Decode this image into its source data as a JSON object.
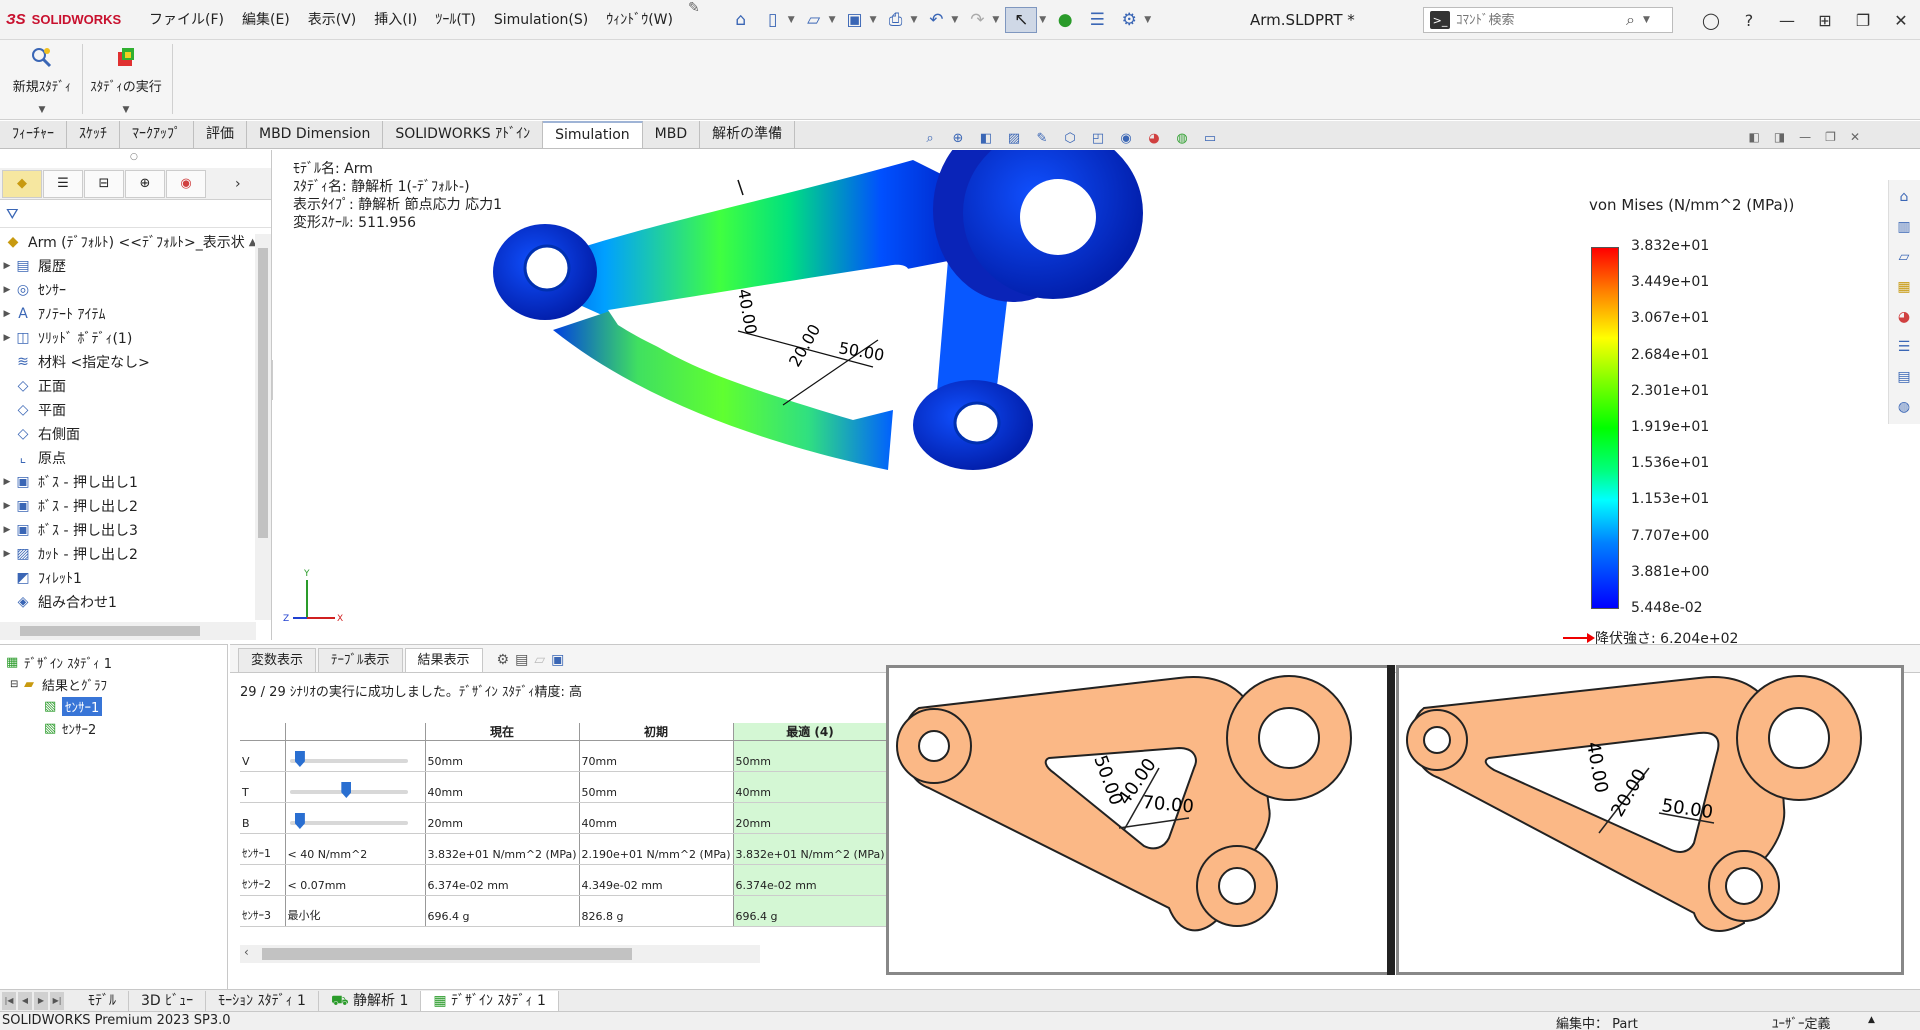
{
  "app": {
    "brand": "SOLIDWORKS",
    "doc_title": "Arm.SLDPRT *",
    "menus": [
      "ファイル(F)",
      "編集(E)",
      "表示(V)",
      "挿入(I)",
      "ﾂｰﾙ(T)",
      "Simulation(S)",
      "ｳｨﾝﾄﾞｳ(W)"
    ],
    "search_placeholder": "ｺﾏﾝﾄﾞ検索"
  },
  "command_manager": {
    "new_study": "新規ｽﾀﾃﾞｨ",
    "run_study": "ｽﾀﾃﾞｨの実行",
    "tabs": [
      "ﾌｨｰﾁｬｰ",
      "ｽｹｯﾁ",
      "ﾏｰｸｱｯﾌﾟ",
      "評価",
      "MBD Dimension",
      "SOLIDWORKS ｱﾄﾞｲﾝ",
      "Simulation",
      "MBD",
      "解析の準備"
    ],
    "active_tab": "Simulation"
  },
  "feature_tree": {
    "root": "Arm (ﾃﾞﾌｫﾙﾄ) <<ﾃﾞﾌｫﾙﾄ>_表示状",
    "items": [
      {
        "label": "履歴",
        "icon": "history-icon",
        "expandable": true
      },
      {
        "label": "ｾﾝｻｰ",
        "icon": "sensor-icon",
        "expandable": true
      },
      {
        "label": "ｱﾉﾃｰﾄ ｱｲﾃﾑ",
        "icon": "annotation-icon",
        "expandable": true
      },
      {
        "label": "ｿﾘｯﾄﾞ ﾎﾞﾃﾞｨ(1)",
        "icon": "solid-body-icon",
        "expandable": true
      },
      {
        "label": "材料 <指定なし>",
        "icon": "material-icon",
        "expandable": false
      },
      {
        "label": "正面",
        "icon": "plane-icon",
        "expandable": false
      },
      {
        "label": "平面",
        "icon": "plane-icon",
        "expandable": false
      },
      {
        "label": "右側面",
        "icon": "plane-icon",
        "expandable": false
      },
      {
        "label": "原点",
        "icon": "origin-icon",
        "expandable": false
      },
      {
        "label": "ﾎﾞｽ - 押し出し1",
        "icon": "boss-extrude-icon",
        "expandable": true
      },
      {
        "label": "ﾎﾞｽ - 押し出し2",
        "icon": "boss-extrude-icon",
        "expandable": true
      },
      {
        "label": "ﾎﾞｽ - 押し出し3",
        "icon": "boss-extrude-icon",
        "expandable": true
      },
      {
        "label": "ｶｯﾄ - 押し出し2",
        "icon": "cut-extrude-icon",
        "expandable": true
      },
      {
        "label": "ﾌｨﾚｯﾄ1",
        "icon": "fillet-icon",
        "expandable": false
      },
      {
        "label": "組み合わせ1",
        "icon": "combine-icon",
        "expandable": false
      }
    ]
  },
  "graphics": {
    "info_lines": [
      "ﾓﾃﾞﾙ名: Arm",
      "ｽﾀﾃﾞｨ名: 静解析 1(-ﾃﾞﾌｫﾙﾄ-)",
      "表示ﾀｲﾌﾟ: 静解析 節点応力 応力1",
      "変形ｽｹｰﾙ: 511.956"
    ],
    "dims": [
      "40.00",
      "20.00",
      "50.00"
    ],
    "legend_title": "von Mises (N/mm^2 (MPa))",
    "legend_values": [
      "3.832e+01",
      "3.449e+01",
      "3.067e+01",
      "2.684e+01",
      "2.301e+01",
      "1.919e+01",
      "1.536e+01",
      "1.153e+01",
      "7.707e+00",
      "3.881e+00",
      "5.448e-02"
    ],
    "yield": "降伏強さ: 6.204e+02",
    "triad": {
      "x": "X",
      "y": "Y",
      "z": "Z"
    }
  },
  "design_study_tree": {
    "root": "ﾃﾞｻﾞｲﾝ ｽﾀﾃﾞｨ 1",
    "results": "結果とｸﾞﾗﾌ",
    "sensors": [
      "ｾﾝｻｰ1",
      "ｾﾝｻｰ2"
    ]
  },
  "design_study": {
    "tabs": [
      "変数表示",
      "ﾃｰﾌﾞﾙ表示",
      "結果表示"
    ],
    "active_tab": "結果表示",
    "message": "29 / 29 ｼﾅﾘｵの実行に成功しました。ﾃﾞｻﾞｲﾝ ｽﾀﾃﾞｨ精度: 高",
    "columns": [
      "",
      "",
      "現在",
      "初期",
      "最適 (4)"
    ],
    "rows": [
      {
        "name": "V",
        "condition": "",
        "current": "50mm",
        "initial": "70mm",
        "optimal": "50mm",
        "slider": 0.05
      },
      {
        "name": "T",
        "condition": "",
        "current": "40mm",
        "initial": "50mm",
        "optimal": "40mm",
        "slider": 0.48
      },
      {
        "name": "B",
        "condition": "",
        "current": "20mm",
        "initial": "40mm",
        "optimal": "20mm",
        "slider": 0.05
      },
      {
        "name": "ｾﾝｻｰ1",
        "condition": "< 40 N/mm^2",
        "current": "3.832e+01 N/mm^2 (MPa)",
        "initial": "2.190e+01 N/mm^2 (MPa)",
        "optimal": "3.832e+01 N/mm^2 (MPa)"
      },
      {
        "name": "ｾﾝｻｰ2",
        "condition": "< 0.07mm",
        "current": "6.374e-02 mm",
        "initial": "4.349e-02 mm",
        "optimal": "6.374e-02 mm"
      },
      {
        "name": "ｾﾝｻｰ3",
        "condition": "最小化",
        "current": "696.4 g",
        "initial": "826.8 g",
        "optimal": "696.4 g"
      }
    ],
    "shape_a_dims": [
      "50.00",
      "40.00",
      "70.00"
    ],
    "shape_b_dims": [
      "40.00",
      "20.00",
      "50.00"
    ]
  },
  "model_tabs": [
    "ﾓﾃﾞﾙ",
    "3D ﾋﾞｭｰ",
    "ﾓｰｼｮﾝ ｽﾀﾃﾞｨ 1",
    "静解析 1",
    "ﾃﾞｻﾞｲﾝ ｽﾀﾃﾞｨ 1"
  ],
  "active_model_tab": "ﾃﾞｻﾞｲﾝ ｽﾀﾃﾞｨ 1",
  "status": {
    "left": "SOLIDWORKS Premium 2023 SP3.0",
    "editing": "編集中： Part",
    "units": "ﾕｰｻﾞｰ定義"
  },
  "colors": {
    "accent": "#3875d7",
    "brand": "#c8102e",
    "optimal_col": "#d4f7d4",
    "shape_fill": "#fbb886"
  }
}
